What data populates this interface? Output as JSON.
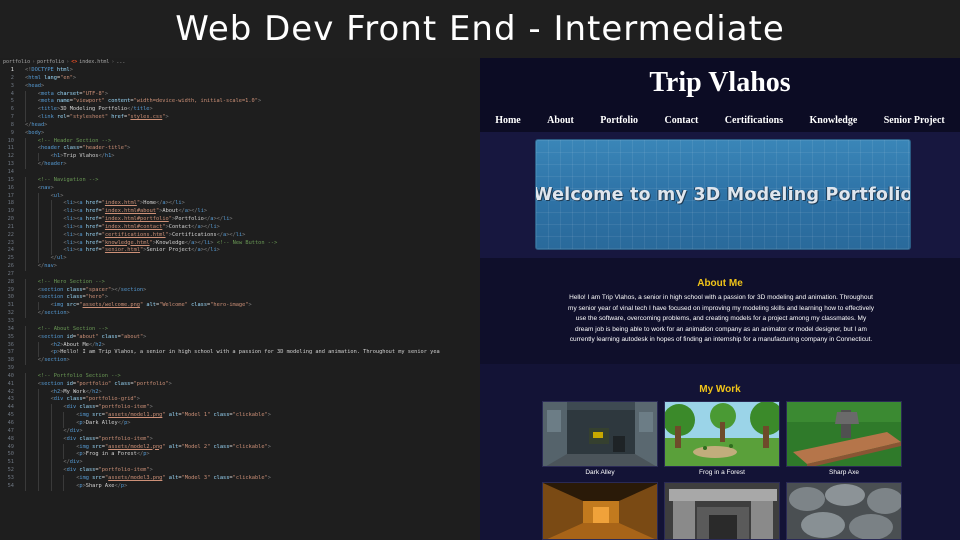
{
  "banner": {
    "title": "Web Dev Front End - Intermediate"
  },
  "editor": {
    "breadcrumbs": [
      "portfolio",
      "portfolio",
      "index.html",
      "..."
    ],
    "lines": [
      {
        "n": "1",
        "i": 0,
        "h": "<span class=\"c-br\">&lt;!</span><span class=\"c-tag\">DOCTYPE</span> <span class=\"c-attr\">html</span><span class=\"c-br\">&gt;</span>"
      },
      {
        "n": "2",
        "i": 0,
        "h": "<span class=\"c-br\">&lt;</span><span class=\"c-tag\">html</span> <span class=\"c-attr\">lang</span>=<span class=\"c-str\">\"en\"</span><span class=\"c-br\">&gt;</span>"
      },
      {
        "n": "3",
        "i": 0,
        "h": "<span class=\"c-br\">&lt;</span><span class=\"c-tag\">head</span><span class=\"c-br\">&gt;</span>"
      },
      {
        "n": "4",
        "i": 1,
        "h": "<span class=\"c-br\">&lt;</span><span class=\"c-tag\">meta</span> <span class=\"c-attr\">charset</span>=<span class=\"c-str\">\"UTF-8\"</span><span class=\"c-br\">&gt;</span>"
      },
      {
        "n": "5",
        "i": 1,
        "h": "<span class=\"c-br\">&lt;</span><span class=\"c-tag\">meta</span> <span class=\"c-attr\">name</span>=<span class=\"c-str\">\"viewport\"</span> <span class=\"c-attr\">content</span>=<span class=\"c-str\">\"width=device-width, initial-scale=1.0\"</span><span class=\"c-br\">&gt;</span>"
      },
      {
        "n": "6",
        "i": 1,
        "h": "<span class=\"c-br\">&lt;</span><span class=\"c-tag\">title</span><span class=\"c-br\">&gt;</span>3D Modeling Portfolio<span class=\"c-br\">&lt;/</span><span class=\"c-tag\">title</span><span class=\"c-br\">&gt;</span>"
      },
      {
        "n": "7",
        "i": 1,
        "h": "<span class=\"c-br\">&lt;</span><span class=\"c-tag\">link</span> <span class=\"c-attr\">rel</span>=<span class=\"c-str\">\"stylesheet\"</span> <span class=\"c-attr\">href</span>=<span class=\"c-str\">\"</span><span class=\"c-link\">styles.css</span><span class=\"c-str\">\"</span><span class=\"c-br\">&gt;</span>"
      },
      {
        "n": "8",
        "i": 0,
        "h": "<span class=\"c-br\">&lt;/</span><span class=\"c-tag\">head</span><span class=\"c-br\">&gt;</span>"
      },
      {
        "n": "9",
        "i": 0,
        "h": "<span class=\"c-br\">&lt;</span><span class=\"c-tag\">body</span><span class=\"c-br\">&gt;</span>"
      },
      {
        "n": "10",
        "i": 1,
        "h": "<span class=\"c-cmt\">&lt;!-- Header Section --&gt;</span>"
      },
      {
        "n": "11",
        "i": 1,
        "h": "<span class=\"c-br\">&lt;</span><span class=\"c-tag\">header</span> <span class=\"c-attr\">class</span>=<span class=\"c-str\">\"header-title\"</span><span class=\"c-br\">&gt;</span>"
      },
      {
        "n": "12",
        "i": 2,
        "h": "<span class=\"c-br\">&lt;</span><span class=\"c-tag\">h1</span><span class=\"c-br\">&gt;</span>Trip Vlahos<span class=\"c-br\">&lt;/</span><span class=\"c-tag\">h1</span><span class=\"c-br\">&gt;</span>"
      },
      {
        "n": "13",
        "i": 1,
        "h": "<span class=\"c-br\">&lt;/</span><span class=\"c-tag\">header</span><span class=\"c-br\">&gt;</span>"
      },
      {
        "n": "14",
        "i": 0,
        "h": ""
      },
      {
        "n": "15",
        "i": 1,
        "h": "<span class=\"c-cmt\">&lt;!-- Navigation --&gt;</span>"
      },
      {
        "n": "16",
        "i": 1,
        "h": "<span class=\"c-br\">&lt;</span><span class=\"c-tag\">nav</span><span class=\"c-br\">&gt;</span>"
      },
      {
        "n": "17",
        "i": 2,
        "h": "<span class=\"c-br\">&lt;</span><span class=\"c-tag\">ul</span><span class=\"c-br\">&gt;</span>"
      },
      {
        "n": "18",
        "i": 3,
        "h": "<span class=\"c-br\">&lt;</span><span class=\"c-tag\">li</span><span class=\"c-br\">&gt;&lt;</span><span class=\"c-tag\">a</span> <span class=\"c-attr\">href</span>=<span class=\"c-str\">\"</span><span class=\"c-link\">index.html</span><span class=\"c-str\">\"</span><span class=\"c-br\">&gt;</span>Home<span class=\"c-br\">&lt;/</span><span class=\"c-tag\">a</span><span class=\"c-br\">&gt;&lt;/</span><span class=\"c-tag\">li</span><span class=\"c-br\">&gt;</span>"
      },
      {
        "n": "19",
        "i": 3,
        "h": "<span class=\"c-br\">&lt;</span><span class=\"c-tag\">li</span><span class=\"c-br\">&gt;&lt;</span><span class=\"c-tag\">a</span> <span class=\"c-attr\">href</span>=<span class=\"c-str\">\"</span><span class=\"c-link\">index.html#about</span><span class=\"c-str\">\"</span><span class=\"c-br\">&gt;</span>About<span class=\"c-br\">&lt;/</span><span class=\"c-tag\">a</span><span class=\"c-br\">&gt;&lt;/</span><span class=\"c-tag\">li</span><span class=\"c-br\">&gt;</span>"
      },
      {
        "n": "20",
        "i": 3,
        "h": "<span class=\"c-br\">&lt;</span><span class=\"c-tag\">li</span><span class=\"c-br\">&gt;&lt;</span><span class=\"c-tag\">a</span> <span class=\"c-attr\">href</span>=<span class=\"c-str\">\"</span><span class=\"c-link\">index.html#portfolio</span><span class=\"c-str\">\"</span><span class=\"c-br\">&gt;</span>Portfolio<span class=\"c-br\">&lt;/</span><span class=\"c-tag\">a</span><span class=\"c-br\">&gt;&lt;/</span><span class=\"c-tag\">li</span><span class=\"c-br\">&gt;</span>"
      },
      {
        "n": "21",
        "i": 3,
        "h": "<span class=\"c-br\">&lt;</span><span class=\"c-tag\">li</span><span class=\"c-br\">&gt;&lt;</span><span class=\"c-tag\">a</span> <span class=\"c-attr\">href</span>=<span class=\"c-str\">\"</span><span class=\"c-link\">index.html#contact</span><span class=\"c-str\">\"</span><span class=\"c-br\">&gt;</span>Contact<span class=\"c-br\">&lt;/</span><span class=\"c-tag\">a</span><span class=\"c-br\">&gt;&lt;/</span><span class=\"c-tag\">li</span><span class=\"c-br\">&gt;</span>"
      },
      {
        "n": "22",
        "i": 3,
        "h": "<span class=\"c-br\">&lt;</span><span class=\"c-tag\">li</span><span class=\"c-br\">&gt;&lt;</span><span class=\"c-tag\">a</span> <span class=\"c-attr\">href</span>=<span class=\"c-str\">\"</span><span class=\"c-link\">certifications.html</span><span class=\"c-str\">\"</span><span class=\"c-br\">&gt;</span>Certifications<span class=\"c-br\">&lt;/</span><span class=\"c-tag\">a</span><span class=\"c-br\">&gt;&lt;/</span><span class=\"c-tag\">li</span><span class=\"c-br\">&gt;</span>"
      },
      {
        "n": "23",
        "i": 3,
        "h": "<span class=\"c-br\">&lt;</span><span class=\"c-tag\">li</span><span class=\"c-br\">&gt;&lt;</span><span class=\"c-tag\">a</span> <span class=\"c-attr\">href</span>=<span class=\"c-str\">\"</span><span class=\"c-link\">knowledge.html</span><span class=\"c-str\">\"</span><span class=\"c-br\">&gt;</span>Knowledge<span class=\"c-br\">&lt;/</span><span class=\"c-tag\">a</span><span class=\"c-br\">&gt;&lt;/</span><span class=\"c-tag\">li</span><span class=\"c-br\">&gt;</span> <span class=\"c-cmt\">&lt;!-- New Button --&gt;</span>"
      },
      {
        "n": "24",
        "i": 3,
        "h": "<span class=\"c-br\">&lt;</span><span class=\"c-tag\">li</span><span class=\"c-br\">&gt;&lt;</span><span class=\"c-tag\">a</span> <span class=\"c-attr\">href</span>=<span class=\"c-str\">\"</span><span class=\"c-link\">senior.html</span><span class=\"c-str\">\"</span><span class=\"c-br\">&gt;</span>Senior Project<span class=\"c-br\">&lt;/</span><span class=\"c-tag\">a</span><span class=\"c-br\">&gt;&lt;/</span><span class=\"c-tag\">li</span><span class=\"c-br\">&gt;</span>"
      },
      {
        "n": "25",
        "i": 2,
        "h": "<span class=\"c-br\">&lt;/</span><span class=\"c-tag\">ul</span><span class=\"c-br\">&gt;</span>"
      },
      {
        "n": "26",
        "i": 1,
        "h": "<span class=\"c-br\">&lt;/</span><span class=\"c-tag\">nav</span><span class=\"c-br\">&gt;</span>"
      },
      {
        "n": "27",
        "i": 0,
        "h": ""
      },
      {
        "n": "28",
        "i": 1,
        "h": "<span class=\"c-cmt\">&lt;!-- Hero Section --&gt;</span>"
      },
      {
        "n": "29",
        "i": 1,
        "h": "<span class=\"c-br\">&lt;</span><span class=\"c-tag\">section</span> <span class=\"c-attr\">class</span>=<span class=\"c-str\">\"spacer\"</span><span class=\"c-br\">&gt;&lt;/</span><span class=\"c-tag\">section</span><span class=\"c-br\">&gt;</span>"
      },
      {
        "n": "30",
        "i": 1,
        "h": "<span class=\"c-br\">&lt;</span><span class=\"c-tag\">section</span> <span class=\"c-attr\">class</span>=<span class=\"c-str\">\"hero\"</span><span class=\"c-br\">&gt;</span>"
      },
      {
        "n": "31",
        "i": 2,
        "h": "<span class=\"c-br\">&lt;</span><span class=\"c-tag\">img</span> <span class=\"c-attr\">src</span>=<span class=\"c-str\">\"</span><span class=\"c-link\">assets/welcome.png</span><span class=\"c-str\">\"</span> <span class=\"c-attr\">alt</span>=<span class=\"c-str\">\"Welcome\"</span> <span class=\"c-attr\">class</span>=<span class=\"c-str\">\"hero-image\"</span><span class=\"c-br\">&gt;</span>"
      },
      {
        "n": "32",
        "i": 1,
        "h": "<span class=\"c-br\">&lt;/</span><span class=\"c-tag\">section</span><span class=\"c-br\">&gt;</span>"
      },
      {
        "n": "33",
        "i": 0,
        "h": ""
      },
      {
        "n": "34",
        "i": 1,
        "h": "<span class=\"c-cmt\">&lt;!-- About Section --&gt;</span>"
      },
      {
        "n": "35",
        "i": 1,
        "h": "<span class=\"c-br\">&lt;</span><span class=\"c-tag\">section</span> <span class=\"c-attr\">id</span>=<span class=\"c-str\">\"about\"</span> <span class=\"c-attr\">class</span>=<span class=\"c-str\">\"about\"</span><span class=\"c-br\">&gt;</span>"
      },
      {
        "n": "36",
        "i": 2,
        "h": "<span class=\"c-br\">&lt;</span><span class=\"c-tag\">h2</span><span class=\"c-br\">&gt;</span>About Me<span class=\"c-br\">&lt;/</span><span class=\"c-tag\">h2</span><span class=\"c-br\">&gt;</span>"
      },
      {
        "n": "37",
        "i": 2,
        "h": "<span class=\"c-br\">&lt;</span><span class=\"c-tag\">p</span><span class=\"c-br\">&gt;</span>Hello! I am Trip Vlahos, a senior in high school with a passion for 3D modeling and animation. Throughout my senior yea"
      },
      {
        "n": "38",
        "i": 1,
        "h": "<span class=\"c-br\">&lt;/</span><span class=\"c-tag\">section</span><span class=\"c-br\">&gt;</span>"
      },
      {
        "n": "39",
        "i": 0,
        "h": ""
      },
      {
        "n": "40",
        "i": 1,
        "h": "<span class=\"c-cmt\">&lt;!-- Portfolio Section --&gt;</span>"
      },
      {
        "n": "41",
        "i": 1,
        "h": "<span class=\"c-br\">&lt;</span><span class=\"c-tag\">section</span> <span class=\"c-attr\">id</span>=<span class=\"c-str\">\"portfolio\"</span> <span class=\"c-attr\">class</span>=<span class=\"c-str\">\"portfolio\"</span><span class=\"c-br\">&gt;</span>"
      },
      {
        "n": "42",
        "i": 2,
        "h": "<span class=\"c-br\">&lt;</span><span class=\"c-tag\">h2</span><span class=\"c-br\">&gt;</span>My Work<span class=\"c-br\">&lt;/</span><span class=\"c-tag\">h2</span><span class=\"c-br\">&gt;</span>"
      },
      {
        "n": "43",
        "i": 2,
        "h": "<span class=\"c-br\">&lt;</span><span class=\"c-tag\">div</span> <span class=\"c-attr\">class</span>=<span class=\"c-str\">\"portfolio-grid\"</span><span class=\"c-br\">&gt;</span>"
      },
      {
        "n": "44",
        "i": 3,
        "h": "<span class=\"c-br\">&lt;</span><span class=\"c-tag\">div</span> <span class=\"c-attr\">class</span>=<span class=\"c-str\">\"portfolio-item\"</span><span class=\"c-br\">&gt;</span>"
      },
      {
        "n": "45",
        "i": 4,
        "h": "<span class=\"c-br\">&lt;</span><span class=\"c-tag\">img</span> <span class=\"c-attr\">src</span>=<span class=\"c-str\">\"</span><span class=\"c-link\">assets/model1.png</span><span class=\"c-str\">\"</span> <span class=\"c-attr\">alt</span>=<span class=\"c-str\">\"Model 1\"</span> <span class=\"c-attr\">class</span>=<span class=\"c-str\">\"clickable\"</span><span class=\"c-br\">&gt;</span>"
      },
      {
        "n": "46",
        "i": 4,
        "h": "<span class=\"c-br\">&lt;</span><span class=\"c-tag\">p</span><span class=\"c-br\">&gt;</span>Dark Alley<span class=\"c-br\">&lt;/</span><span class=\"c-tag\">p</span><span class=\"c-br\">&gt;</span>"
      },
      {
        "n": "47",
        "i": 3,
        "h": "<span class=\"c-br\">&lt;/</span><span class=\"c-tag\">div</span><span class=\"c-br\">&gt;</span>"
      },
      {
        "n": "48",
        "i": 3,
        "h": "<span class=\"c-br\">&lt;</span><span class=\"c-tag\">div</span> <span class=\"c-attr\">class</span>=<span class=\"c-str\">\"portfolio-item\"</span><span class=\"c-br\">&gt;</span>"
      },
      {
        "n": "49",
        "i": 4,
        "h": "<span class=\"c-br\">&lt;</span><span class=\"c-tag\">img</span> <span class=\"c-attr\">src</span>=<span class=\"c-str\">\"</span><span class=\"c-link\">assets/model2.png</span><span class=\"c-str\">\"</span> <span class=\"c-attr\">alt</span>=<span class=\"c-str\">\"Model 2\"</span> <span class=\"c-attr\">class</span>=<span class=\"c-str\">\"clickable\"</span><span class=\"c-br\">&gt;</span>"
      },
      {
        "n": "50",
        "i": 4,
        "h": "<span class=\"c-br\">&lt;</span><span class=\"c-tag\">p</span><span class=\"c-br\">&gt;</span>Frog in a Forest<span class=\"c-br\">&lt;/</span><span class=\"c-tag\">p</span><span class=\"c-br\">&gt;</span>"
      },
      {
        "n": "51",
        "i": 3,
        "h": "<span class=\"c-br\">&lt;/</span><span class=\"c-tag\">div</span><span class=\"c-br\">&gt;</span>"
      },
      {
        "n": "52",
        "i": 3,
        "h": "<span class=\"c-br\">&lt;</span><span class=\"c-tag\">div</span> <span class=\"c-attr\">class</span>=<span class=\"c-str\">\"portfolio-item\"</span><span class=\"c-br\">&gt;</span>"
      },
      {
        "n": "53",
        "i": 4,
        "h": "<span class=\"c-br\">&lt;</span><span class=\"c-tag\">img</span> <span class=\"c-attr\">src</span>=<span class=\"c-str\">\"</span><span class=\"c-link\">assets/model3.png</span><span class=\"c-str\">\"</span> <span class=\"c-attr\">alt</span>=<span class=\"c-str\">\"Model 3\"</span> <span class=\"c-attr\">class</span>=<span class=\"c-str\">\"clickable\"</span><span class=\"c-br\">&gt;</span>"
      },
      {
        "n": "54",
        "i": 4,
        "h": "<span class=\"c-br\">&lt;</span><span class=\"c-tag\">p</span><span class=\"c-br\">&gt;</span>Sharp Axe<span class=\"c-br\">&lt;/</span><span class=\"c-tag\">p</span><span class=\"c-br\">&gt;</span>"
      }
    ]
  },
  "site": {
    "title": "Trip Vlahos",
    "nav": [
      "Home",
      "About",
      "Portfolio",
      "Contact",
      "Certifications",
      "Knowledge",
      "Senior Project"
    ],
    "hero_text": "Welcome to my 3D Modeling Portfolio",
    "about_heading": "About Me",
    "about_text": "Hello! I am Trip Vlahos, a senior in high school with a passion for 3D modeling and animation. Throughout my senior year of vinal tech I have focused on improving my modeling skills and learning how to effectively use the software, overcoming problems, and creating models for a project among my classmates. My dream job is being able to work for an animation company as an animator or model designer, but I am currently learning autodesk in hopes of finding an internship for a manufacturing company in Connecticut.",
    "work_heading": "My Work",
    "portfolio": [
      {
        "caption": "Dark Alley"
      },
      {
        "caption": "Frog in a Forest"
      },
      {
        "caption": "Sharp Axe"
      },
      {
        "caption": ""
      },
      {
        "caption": ""
      },
      {
        "caption": ""
      }
    ],
    "colors": {
      "accent": "#f0c419",
      "page_bg": "#0f0f2b",
      "hero": "#2e73a7"
    }
  }
}
